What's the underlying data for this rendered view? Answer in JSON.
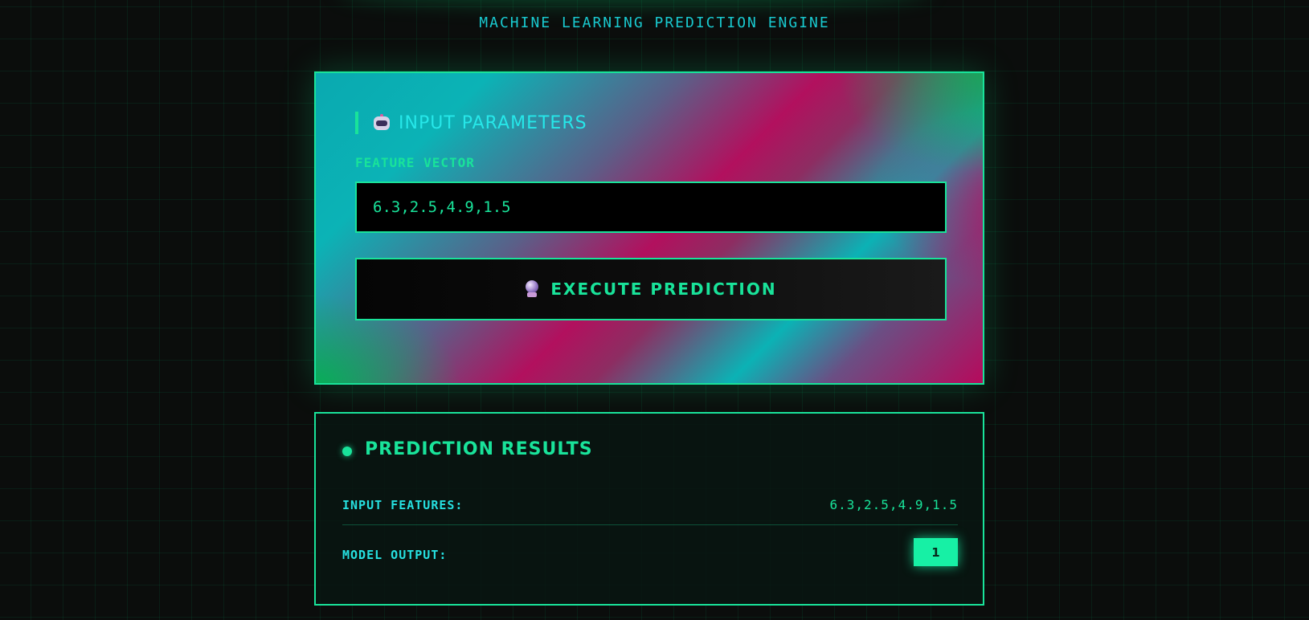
{
  "header": {
    "subtitle": "MACHINE LEARNING PREDICTION ENGINE"
  },
  "input_panel": {
    "title": "INPUT PARAMETERS",
    "title_icon": "robot-icon",
    "field_label": "FEATURE VECTOR",
    "feature_value": "6.3,2.5,4.9,1.5",
    "execute_label": "EXECUTE PREDICTION",
    "execute_icon": "crystal-ball-icon"
  },
  "results_panel": {
    "title": "PREDICTION RESULTS",
    "input_features_label": "INPUT FEATURES:",
    "input_features_value": "6.3,2.5,4.9,1.5",
    "model_output_label": "MODEL OUTPUT:",
    "model_output_value": "1"
  },
  "colors": {
    "accent_green": "#19e39a",
    "accent_cyan": "#26e7e9",
    "accent_magenta": "#b2105e",
    "background": "#0b0d0c"
  }
}
